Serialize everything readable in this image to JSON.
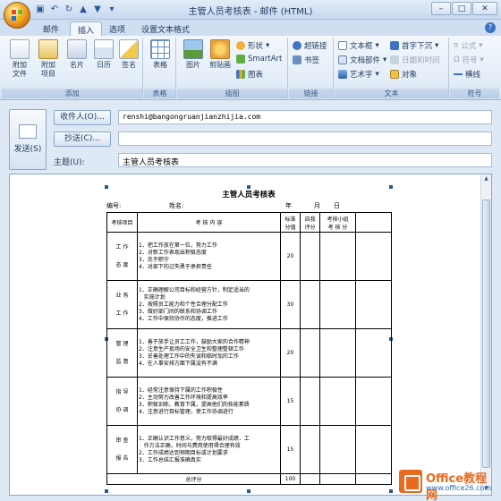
{
  "window": {
    "title": "主管人员考核表 - 邮件 (HTML)"
  },
  "tabs": [
    {
      "label": "邮件"
    },
    {
      "label": "插入"
    },
    {
      "label": "选项"
    },
    {
      "label": "设置文本格式"
    }
  ],
  "ribbon": {
    "groups": {
      "add": {
        "label": "添加",
        "attach_file": "附加\n文件",
        "attach_item": "附加\n项目",
        "business_card": "名片",
        "calendar": "日历",
        "signature": "签名"
      },
      "tables": {
        "label": "表格",
        "table": "表格"
      },
      "illustrations": {
        "label": "插图",
        "picture": "图片",
        "clip_art": "剪贴画",
        "shapes": "形状",
        "smartart": "SmartArt",
        "chart": "图表"
      },
      "links": {
        "label": "链接",
        "hyperlink": "超链接",
        "bookmark": "书签"
      },
      "text": {
        "label": "文本",
        "text_box": "文本框",
        "quick_parts": "文档部件",
        "wordart": "艺术字",
        "drop_cap": "首字下沉",
        "date_time": "日期和时间",
        "object": "对象"
      },
      "symbols": {
        "label": "符号",
        "equation": "公式",
        "symbol": "符号",
        "horizontal_line": "横线"
      }
    }
  },
  "address": {
    "send_label": "发送(S)",
    "to_button": "收件人(O)...",
    "cc_button": "抄送(C)...",
    "subject_label": "主题(U):",
    "to_value": "renshi@bangongruanjianzhijia.com",
    "cc_value": "",
    "subject_value": "主管人员考核表"
  },
  "document": {
    "title": "主管人员考核表",
    "meta": {
      "code": "编号:",
      "name": "姓名:",
      "year": "年",
      "month": "月",
      "day": "日"
    },
    "headers": {
      "category": "考核项目",
      "content": "考 核 内 容",
      "standard": "标准\n分值",
      "self_score": "自我\n评分",
      "group_score": "考核小组\n考 核 分"
    },
    "rows": [
      {
        "category": "工  作\n\n态  度",
        "items": "1．把工作放在第一位，努力工作\n2．对新工作表现出积极态度\n3．忠于职守\n4．对部下的过失勇于承担责任",
        "standard": "20"
      },
      {
        "category": "业  务\n\n工  作",
        "items": "1．正确理解公司目标和经营方针，制定适当的\n   实施计划\n2．按照员工能力和个性合理分配工作\n3．做好部门间的联系和协调工作\n4．工作中保持协作的态度，推进工作",
        "standard": "30"
      },
      {
        "category": "管  理\n\n监  督",
        "items": "1．善于放手让员工工作，鼓励大家的合作精神\n2．注意生产现场的安全卫生和整理整顿工作\n3．妥善处理工作中的失误和临时加的工作\n4．在人事安排方面下属没有不满",
        "standard": "20"
      },
      {
        "category": "指  导\n\n协  调",
        "items": "1．经常注意保持下属的工作积极性\n2．主动努力改善工作环境和提高效率\n3．积极训练、教育下属，提高他们的技能素质\n4．注意进行目标管理，使工作协调进行",
        "standard": "15"
      },
      {
        "category": "审  查\n\n报  告",
        "items": "1．正确认识工作意义，努力取得最好成绩．工\n   作方法正确，时间与费用使用得合理有效\n2．工作成绩达到预期目标或计划要求\n3．工作总结汇报准确真实",
        "standard": "15"
      }
    ],
    "total_label": "总评分",
    "total_value": "100"
  },
  "watermark": {
    "text1": "Office教程网",
    "text2": "www.office26.com"
  }
}
